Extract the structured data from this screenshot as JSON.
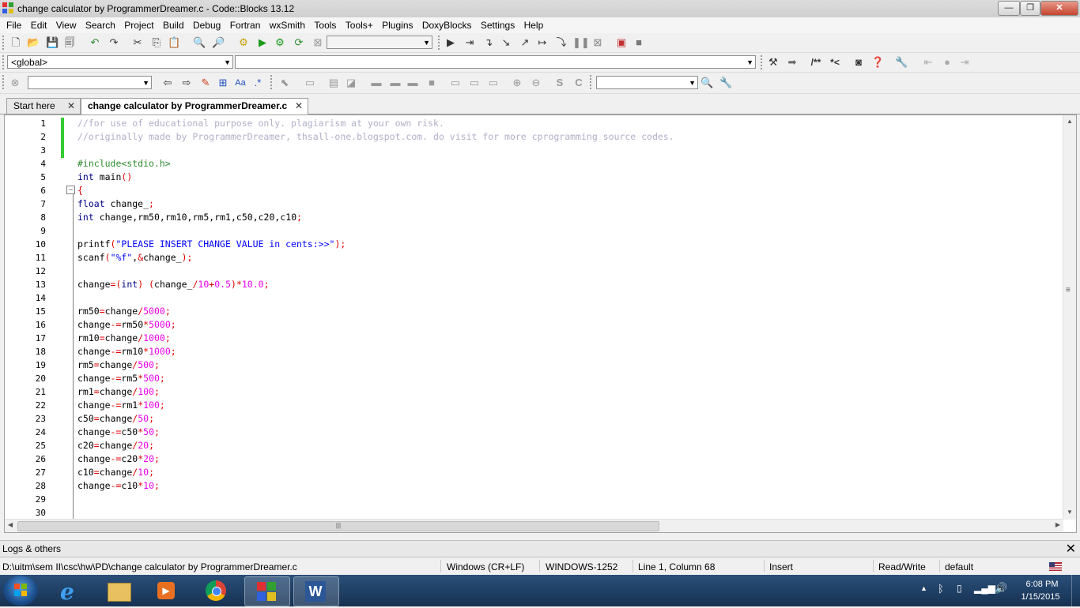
{
  "window": {
    "title": "change calculator by ProgrammerDreamer.c - Code::Blocks 13.12"
  },
  "menu": [
    "File",
    "Edit",
    "View",
    "Search",
    "Project",
    "Build",
    "Debug",
    "Fortran",
    "wxSmith",
    "Tools",
    "Tools+",
    "Plugins",
    "DoxyBlocks",
    "Settings",
    "Help"
  ],
  "toolbar": {
    "scope_value": "<global>",
    "symbol_value": "",
    "doxy_labels": [
      "/**",
      "*<"
    ]
  },
  "tabs": [
    {
      "label": "Start here",
      "active": false
    },
    {
      "label": "change calculator by ProgrammerDreamer.c",
      "active": true
    }
  ],
  "editor": {
    "lines": [
      {
        "n": "1",
        "t": "//for use of educational purpose only. plagiarism at your own risk."
      },
      {
        "n": "2",
        "t": "//originally made by ProgrammerDreamer, thsall-one.blogspot.com. do visit for more cprogramming source codes."
      },
      {
        "n": "3",
        "t": ""
      },
      {
        "n": "4",
        "t": "#include<stdio.h>"
      },
      {
        "n": "5",
        "t": "int main()"
      },
      {
        "n": "6",
        "t": "{"
      },
      {
        "n": "7",
        "t": "float change_;"
      },
      {
        "n": "8",
        "t": "int change,rm50,rm10,rm5,rm1,c50,c20,c10;"
      },
      {
        "n": "9",
        "t": ""
      },
      {
        "n": "10",
        "t": "printf(\"PLEASE INSERT CHANGE VALUE in cents:>>\");"
      },
      {
        "n": "11",
        "t": "scanf(\"%f\",&change_);"
      },
      {
        "n": "12",
        "t": ""
      },
      {
        "n": "13",
        "t": "change=(int) (change_/10+0.5)*10.0;"
      },
      {
        "n": "14",
        "t": ""
      },
      {
        "n": "15",
        "t": "rm50=change/5000;"
      },
      {
        "n": "16",
        "t": "change-=rm50*5000;"
      },
      {
        "n": "17",
        "t": "rm10=change/1000;"
      },
      {
        "n": "18",
        "t": "change-=rm10*1000;"
      },
      {
        "n": "19",
        "t": "rm5=change/500;"
      },
      {
        "n": "20",
        "t": "change-=rm5*500;"
      },
      {
        "n": "21",
        "t": "rm1=change/100;"
      },
      {
        "n": "22",
        "t": "change-=rm1*100;"
      },
      {
        "n": "23",
        "t": "c50=change/50;"
      },
      {
        "n": "24",
        "t": "change-=c50*50;"
      },
      {
        "n": "25",
        "t": "c20=change/20;"
      },
      {
        "n": "26",
        "t": "change-=c20*20;"
      },
      {
        "n": "27",
        "t": "c10=change/10;"
      },
      {
        "n": "28",
        "t": "change-=c10*10;"
      },
      {
        "n": "29",
        "t": ""
      },
      {
        "n": "30",
        "t": ""
      }
    ]
  },
  "logs": {
    "label": "Logs & others",
    "close": "✕"
  },
  "status": {
    "path": "D:\\uitm\\sem II\\csc\\hw\\PD\\change calculator by ProgrammerDreamer.c",
    "eol": "Windows (CR+LF)",
    "encoding": "WINDOWS-1252",
    "position": "Line 1, Column 68",
    "mode": "Insert",
    "access": "Read/Write",
    "profile": "default"
  },
  "taskbar": {
    "time": "6:08 PM",
    "date": "1/15/2015"
  },
  "colors": {
    "comment": "#b0b0c8",
    "preprocessor": "#2e8b2e",
    "keyword": "#00008b",
    "string": "#0000ff",
    "number": "#e800e8",
    "operator": "#e00000"
  }
}
